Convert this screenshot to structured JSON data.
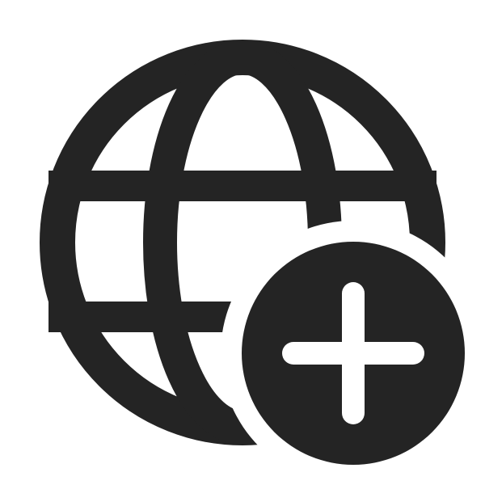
{
  "icon": {
    "name": "globe-add-icon",
    "parts": {
      "globe": "globe-icon",
      "badge": "add-badge-icon",
      "plus": "plus-icon"
    },
    "colors": {
      "foreground": "#242424",
      "background": "#ffffff"
    }
  }
}
